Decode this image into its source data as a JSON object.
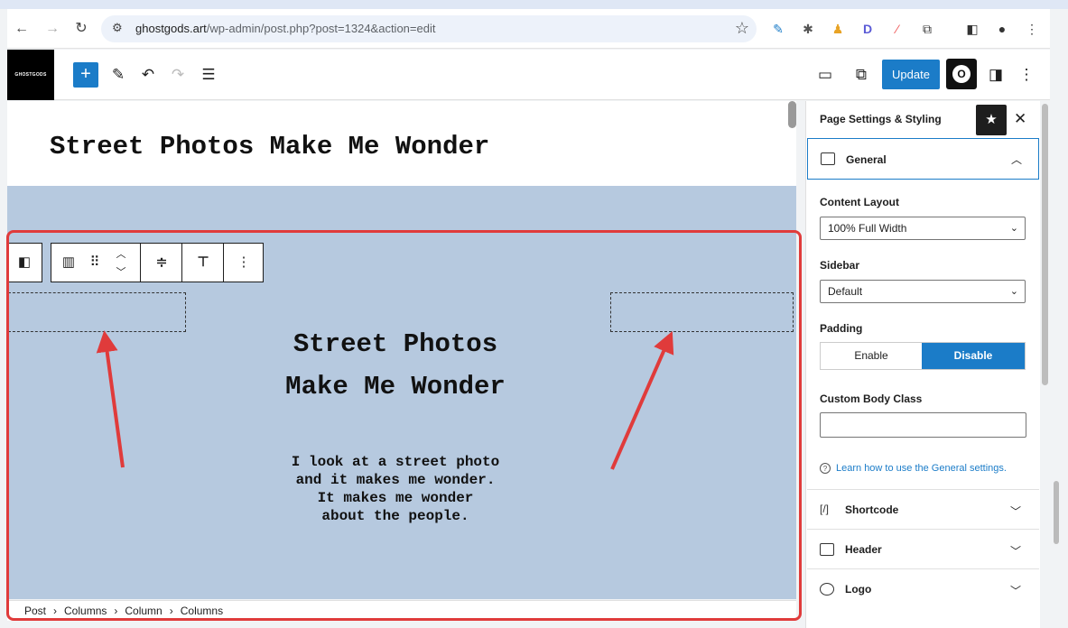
{
  "browser": {
    "url_domain": "ghostgods.art",
    "url_path": "/wp-admin/post.php?post=1324&action=edit"
  },
  "toolbar": {
    "logo_text": "GHOSTGODS",
    "update_label": "Update",
    "o_label": "O"
  },
  "canvas": {
    "post_title": "Street Photos Make Me Wonder",
    "content_title_lines": [
      "Street Photos",
      "Make Me Wonder"
    ],
    "body_lines": [
      "I look at a street photo",
      "and it makes me wonder.",
      "It makes me wonder",
      "about the people."
    ]
  },
  "breadcrumb": [
    "Post",
    "Columns",
    "Column",
    "Columns"
  ],
  "sidebar": {
    "title": "Page Settings & Styling",
    "general_label": "General",
    "content_layout_label": "Content Layout",
    "content_layout_value": "100% Full Width",
    "sidebar_label": "Sidebar",
    "sidebar_value": "Default",
    "padding_label": "Padding",
    "padding_enable": "Enable",
    "padding_disable": "Disable",
    "custom_body_class_label": "Custom Body Class",
    "help_link": "Learn how to use the General settings.",
    "panels": [
      {
        "label": "Shortcode"
      },
      {
        "label": "Header"
      },
      {
        "label": "Logo"
      }
    ]
  },
  "colors": {
    "accent": "#1b7cc8",
    "canvas_bg": "#b6c9df",
    "highlight": "#e03b3b"
  }
}
